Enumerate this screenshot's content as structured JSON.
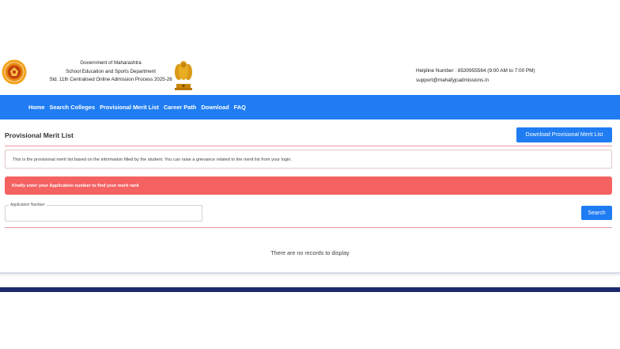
{
  "header": {
    "gov_line1": "Government of Maharashtra",
    "gov_line2": "School Education and Sports Department",
    "gov_line3": "Std. 11th Centralised Online Admission Process 2025-26",
    "helpline": "Helpline Number : 8530955564 (9:00 AM to 7:00 PM)",
    "email": "support@mahafyjcadmissions.in"
  },
  "nav": {
    "items": [
      "Home",
      "Search Colleges",
      "Provisional Merit List",
      "Career Path",
      "Download",
      "FAQ"
    ]
  },
  "main": {
    "title": "Provisional Merit List",
    "download_label": "Download Provisional Merit List",
    "info_text": "This is the provisional merit list based on the information filled by the student. You can raise a grievance related to the merit list from your login.",
    "alert_text": "Kindly enter your Application number to find your merit rank",
    "field_label": "Application Number",
    "field_value": "",
    "search_label": "Search",
    "empty_text": "There are no records to display"
  },
  "colors": {
    "nav_blue": "#1f7cf2",
    "alert_red": "#f56262",
    "footer_navy": "#1b2a6e"
  }
}
